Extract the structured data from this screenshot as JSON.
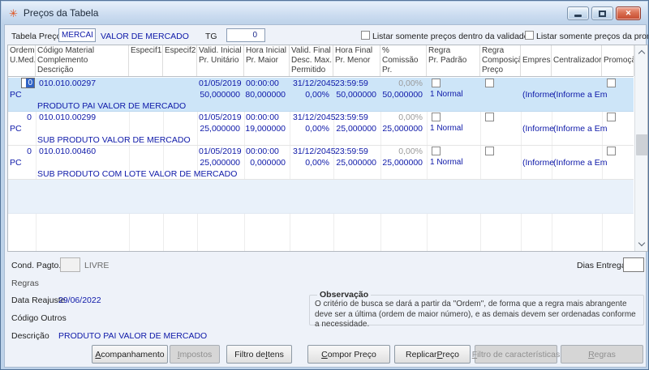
{
  "window": {
    "title": "Preços da Tabela"
  },
  "toolbar": {
    "tabela_preco_label": "Tabela Preço",
    "tabela_preco_value": "MERCAD",
    "tabela_preco_desc": "VALOR DE MERCADO",
    "tg_label": "TG",
    "tg_value": "0",
    "chk_validade_label": "Listar somente preços dentro da validade",
    "chk_promocao_label": "Listar somente preços da promoção"
  },
  "grid": {
    "headers": [
      {
        "text": "Ordem\nU.Med."
      },
      {
        "text": "Código Material\nComplemento\nDescrição"
      },
      {
        "text": "Especif1"
      },
      {
        "text": "Especif2"
      },
      {
        "text": "Valid. Inicial\nPr. Unitário"
      },
      {
        "text": "Hora Inicial\nPr. Maior"
      },
      {
        "text": "Valid. Final\nDesc. Max.\nPermitido"
      },
      {
        "text": "Hora Final\nPr. Menor"
      },
      {
        "text": "% Comissão\nPr. Desconto"
      },
      {
        "text": "Regra\nPr. Padrão"
      },
      {
        "text": "Regra\nComposição\nPreço"
      },
      {
        "text": "Empresa"
      },
      {
        "text": "Centralizadora"
      },
      {
        "text": "Promoção"
      }
    ],
    "records": [
      {
        "selected": true,
        "ordem": "0",
        "umed": "PC",
        "codigo": "010.010.00297",
        "descricao": "PRODUTO PAI VALOR DE MERCADO",
        "valid_inicial": "01/05/2019",
        "hora_inicial": "00:00:00",
        "valid_final": "31/12/2045",
        "hora_final": "23:59:59",
        "comissao": "0,00%",
        "pr_unitario": "50,000000",
        "pr_maior": "80,000000",
        "desc_max": "0,00%",
        "pr_menor": "50,000000",
        "pr_desconto": "50,000000",
        "regra": "1 Normal",
        "empresa": "(Informe",
        "centralizadora": "(Informe a Em"
      },
      {
        "selected": false,
        "ordem": "0",
        "umed": "PC",
        "codigo": "010.010.00299",
        "descricao": "SUB PRODUTO VALOR DE MERCADO",
        "valid_inicial": "01/05/2019",
        "hora_inicial": "00:00:00",
        "valid_final": "31/12/2045",
        "hora_final": "23:59:59",
        "comissao": "0,00%",
        "pr_unitario": "25,000000",
        "pr_maior": "19,000000",
        "desc_max": "0,00%",
        "pr_menor": "25,000000",
        "pr_desconto": "25,000000",
        "regra": "1 Normal",
        "empresa": "(Informe",
        "centralizadora": "(Informe a Em"
      },
      {
        "selected": false,
        "ordem": "0",
        "umed": "PC",
        "codigo": "010.010.00460",
        "descricao": "SUB PRODUTO COM LOTE VALOR DE MERCADO",
        "valid_inicial": "01/05/2019",
        "hora_inicial": "00:00:00",
        "valid_final": "31/12/2045",
        "hora_final": "23:59:59",
        "comissao": "0,00%",
        "pr_unitario": "25,000000",
        "pr_maior": "0,000000",
        "desc_max": "0,00%",
        "pr_menor": "25,000000",
        "pr_desconto": "25,000000",
        "regra": "1 Normal",
        "empresa": "(Informe",
        "centralizadora": "(Informe a Em"
      }
    ]
  },
  "footer": {
    "cond_pagto_label": "Cond. Pagto.",
    "cond_pagto_value": "",
    "cond_pagto_desc": "LIVRE",
    "dias_entrega_label": "Dias Entrega",
    "dias_entrega_value": "",
    "regras_label": "Regras",
    "data_reajuste_label": "Data Reajuste",
    "data_reajuste_value": "29/06/2022",
    "codigo_outros_label": "Código Outros",
    "descricao_label": "Descrição",
    "descricao_value": "PRODUTO PAI VALOR DE MERCADO",
    "observacao_title": "Observação",
    "observacao_text": "O critério de busca se dará a partir da \"Ordem\", de forma que a regra mais abrangente deve ser a última (ordem de maior número), e as demais devem ser ordenadas conforme a necessidade."
  },
  "buttons": [
    {
      "pre": "",
      "key": "A",
      "post": "companhamento",
      "enabled": true
    },
    {
      "pre": "",
      "key": "I",
      "post": "mpostos",
      "enabled": false
    },
    {
      "pre": "Filtro de ",
      "key": "I",
      "post": "tens",
      "enabled": true
    },
    {
      "pre": "",
      "key": "C",
      "post": "ompor Preço",
      "enabled": true
    },
    {
      "pre": "Replicar ",
      "key": "P",
      "post": "reço",
      "enabled": true
    },
    {
      "pre": "",
      "key": "F",
      "post": "iltro de características",
      "enabled": false
    },
    {
      "pre": "",
      "key": "R",
      "post": "egras",
      "enabled": false
    }
  ]
}
